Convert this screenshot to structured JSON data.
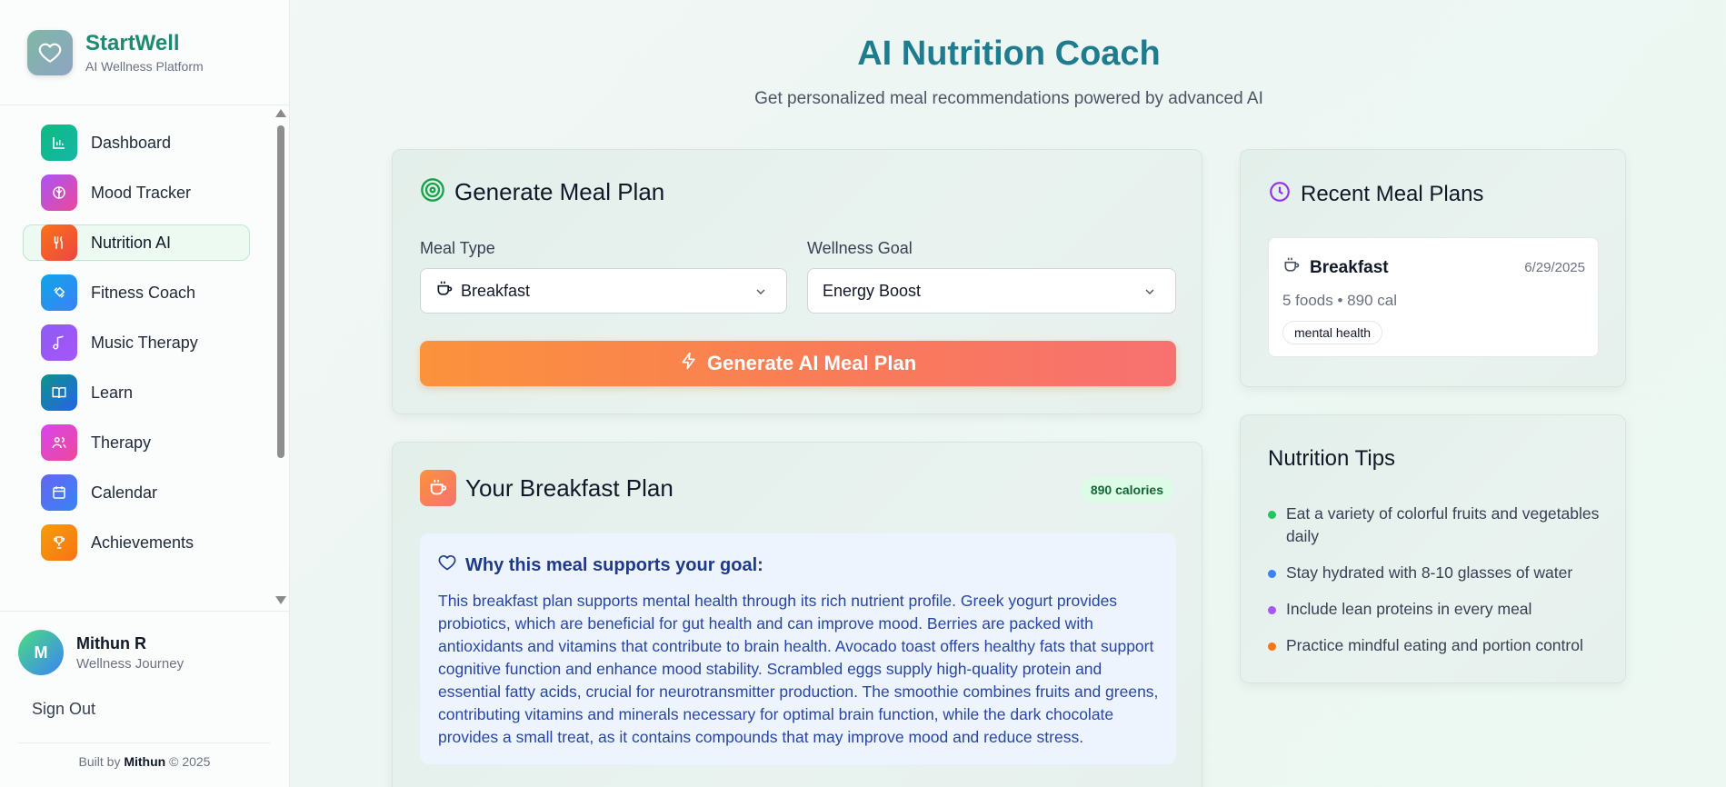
{
  "brand": {
    "name": "StartWell",
    "subtitle": "AI Wellness Platform"
  },
  "sidebar": {
    "items": [
      {
        "label": "Dashboard",
        "icon": "bar-chart-icon",
        "color": "#10b981"
      },
      {
        "label": "Mood Tracker",
        "icon": "brain-icon",
        "color": "#a855f7"
      },
      {
        "label": "Nutrition AI",
        "icon": "utensils-icon",
        "color": "#f97316",
        "active": true
      },
      {
        "label": "Fitness Coach",
        "icon": "dumbbell-icon",
        "color": "#0ea5e9"
      },
      {
        "label": "Music Therapy",
        "icon": "music-note-icon",
        "color": "#8b5cf6"
      },
      {
        "label": "Learn",
        "icon": "book-icon",
        "color": "#0d9488"
      },
      {
        "label": "Therapy",
        "icon": "users-icon",
        "color": "#d946ef"
      },
      {
        "label": "Calendar",
        "icon": "calendar-icon",
        "color": "#6366f1"
      },
      {
        "label": "Achievements",
        "icon": "trophy-icon",
        "color": "#f59e0b"
      }
    ]
  },
  "user": {
    "initial": "M",
    "name": "Mithun R",
    "role": "Wellness Journey"
  },
  "sign_out": "Sign Out",
  "footer": {
    "prefix": "Built by",
    "author": "Mithun",
    "suffix": "© 2025"
  },
  "page": {
    "title": "AI Nutrition Coach",
    "subtitle": "Get personalized meal recommendations powered by advanced AI"
  },
  "generator": {
    "title": "Generate Meal Plan",
    "meal_type_label": "Meal Type",
    "meal_type_value": "Breakfast",
    "goal_label": "Wellness Goal",
    "goal_value": "Energy Boost",
    "button": "Generate AI Meal Plan"
  },
  "plan": {
    "title": "Your Breakfast Plan",
    "calories": "890 calories",
    "why_title": "Why this meal supports your goal:",
    "why_text": "This breakfast plan supports mental health through its rich nutrient profile. Greek yogurt provides probiotics, which are beneficial for gut health and can improve mood. Berries are packed with antioxidants and vitamins that contribute to brain health. Avocado toast offers healthy fats that support cognitive function and enhance mood stability. Scrambled eggs supply high-quality protein and essential fatty acids, crucial for neurotransmitter production. The smoothie combines fruits and greens, contributing vitamins and minerals necessary for optimal brain function, while the dark chocolate provides a small treat, as it contains compounds that may improve mood and reduce stress."
  },
  "recent": {
    "title": "Recent Meal Plans",
    "items": [
      {
        "meal": "Breakfast",
        "date": "6/29/2025",
        "meta": "5 foods • 890 cal",
        "tag": "mental health"
      }
    ]
  },
  "tips": {
    "title": "Nutrition Tips",
    "items": [
      {
        "text": "Eat a variety of colorful fruits and vegetables daily",
        "color": "#22c55e"
      },
      {
        "text": "Stay hydrated with 8-10 glasses of water",
        "color": "#3b82f6"
      },
      {
        "text": "Include lean proteins in every meal",
        "color": "#a855f7"
      },
      {
        "text": "Practice mindful eating and portion control",
        "color": "#f97316"
      }
    ]
  }
}
